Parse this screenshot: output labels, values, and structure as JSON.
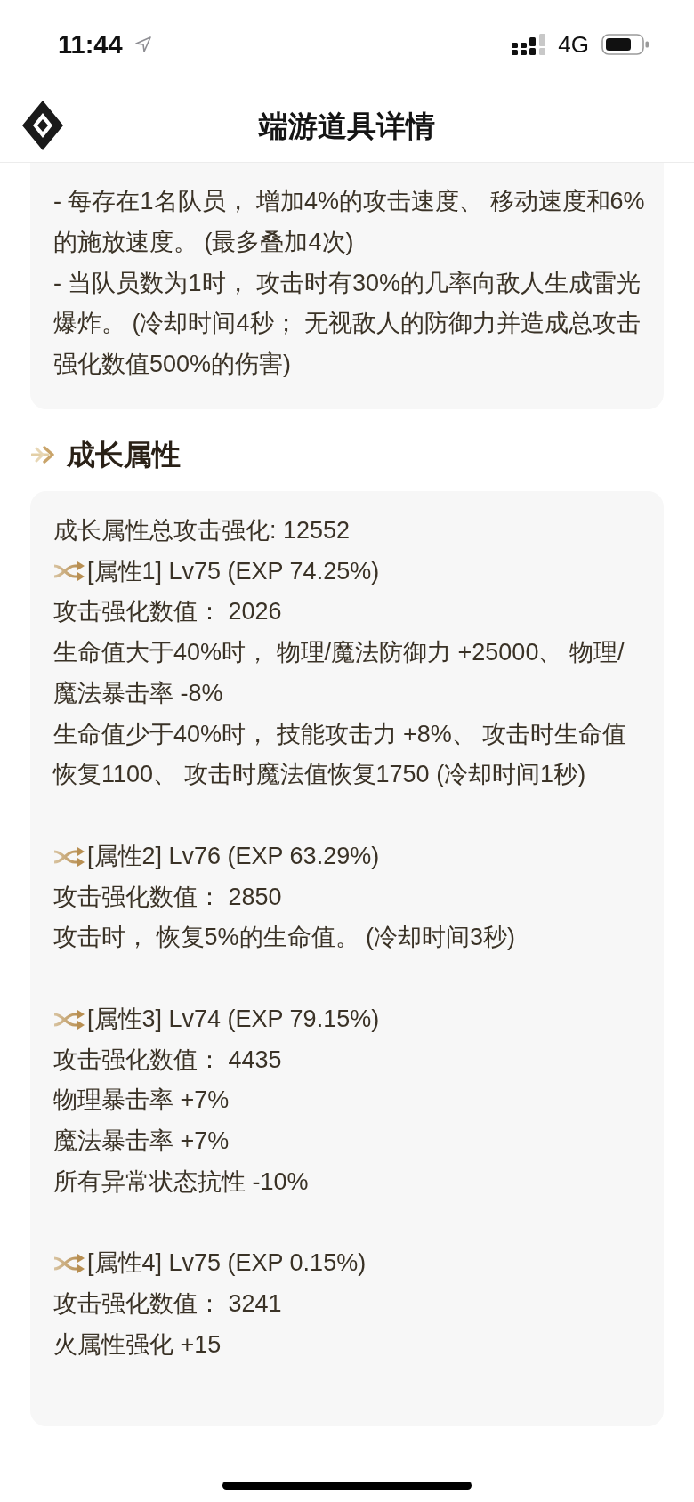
{
  "status_bar": {
    "time": "11:44",
    "network": "4G"
  },
  "header": {
    "title": "端游道具详情"
  },
  "effect_card": {
    "lines": [
      "- 每存在1名队员， 增加4%的攻击速度、 移动速度和6%的施放速度。 (最多叠加4次)",
      "- 当队员数为1时， 攻击时有30%的几率向敌人生成雷光爆炸。 (冷却时间4秒； 无视敌人的防御力并造成总攻击强化数值500%的伤害)"
    ]
  },
  "growth_section": {
    "title": "成长属性",
    "total": "成长属性总攻击强化: 12552",
    "attributes": [
      {
        "title": "[属性1] Lv75 (EXP 74.25%)",
        "lines": [
          "攻击强化数值： 2026",
          "生命值大于40%时， 物理/魔法防御力 +25000、 物理/魔法暴击率 -8%",
          "生命值少于40%时， 技能攻击力 +8%、 攻击时生命值恢复1100、 攻击时魔法值恢复1750 (冷却时间1秒)"
        ]
      },
      {
        "title": "[属性2] Lv76 (EXP 63.29%)",
        "lines": [
          "攻击强化数值： 2850",
          "攻击时， 恢复5%的生命值。 (冷却时间3秒)"
        ]
      },
      {
        "title": "[属性3] Lv74 (EXP 79.15%)",
        "lines": [
          "攻击强化数值： 4435",
          "物理暴击率 +7%",
          "魔法暴击率 +7%",
          "所有异常状态抗性 -10%"
        ]
      },
      {
        "title": "[属性4] Lv75 (EXP 0.15%)",
        "lines": [
          "攻击强化数值： 3241",
          "火属性强化 +15"
        ]
      }
    ]
  }
}
